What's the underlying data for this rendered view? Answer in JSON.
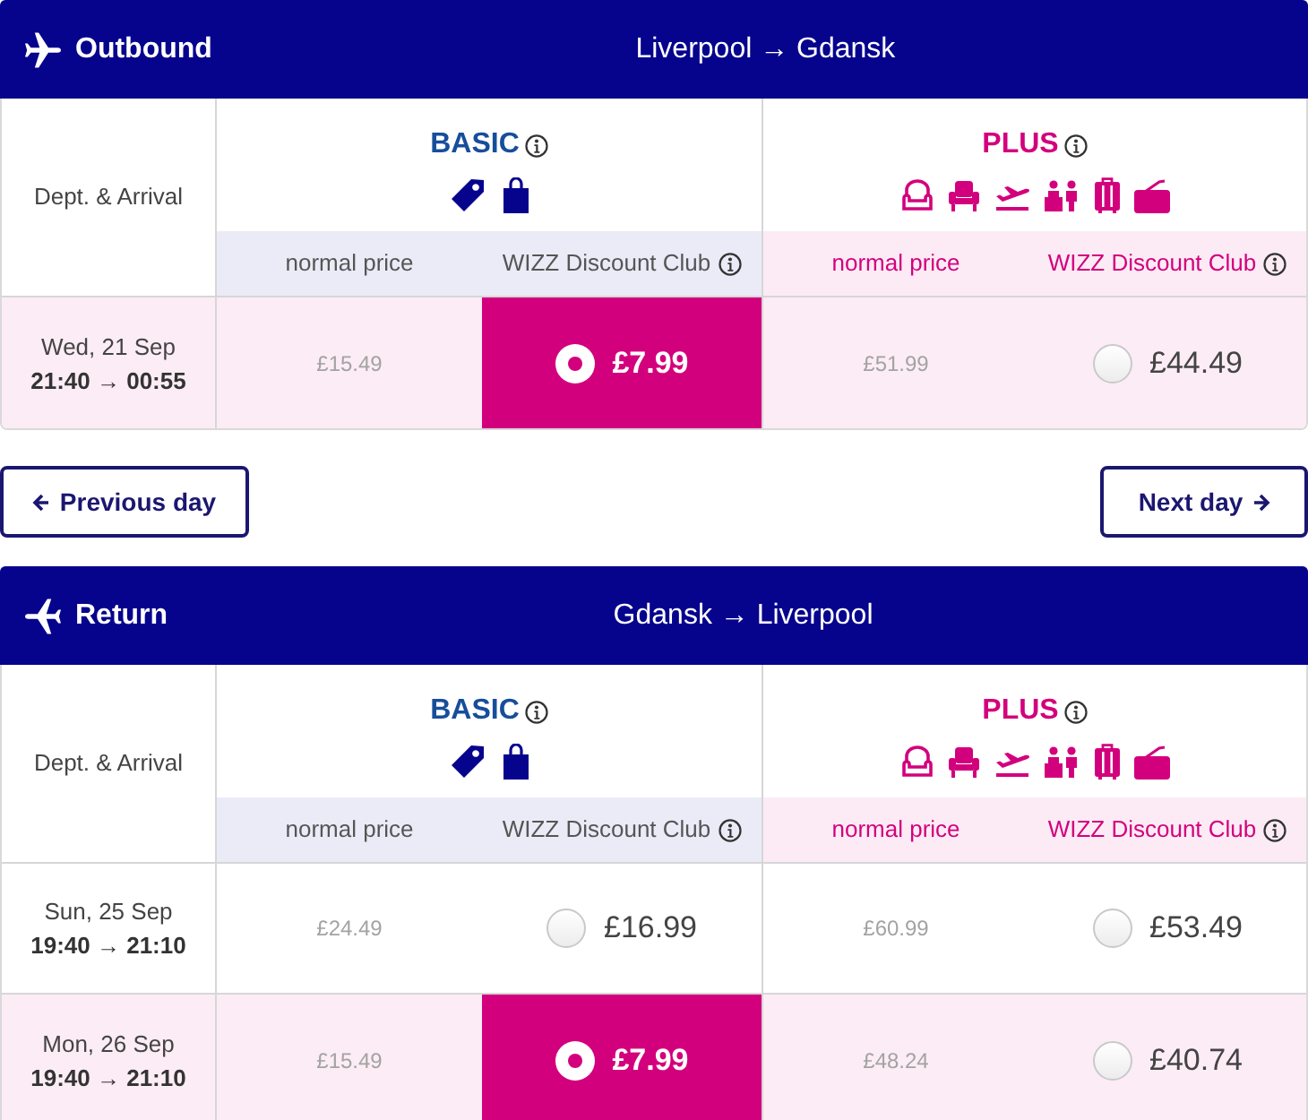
{
  "outbound": {
    "title": "Outbound",
    "route": "Liverpool → Gdansk",
    "date_header": "Dept. & Arrival",
    "fares": [
      {
        "kind": "basic",
        "name": "BASIC",
        "normal_label": "normal price",
        "club_label": "WIZZ Discount Club"
      },
      {
        "kind": "plus",
        "name": "PLUS",
        "normal_label": "normal price",
        "club_label": "WIZZ Discount Club"
      }
    ],
    "rows": [
      {
        "date": "Wed, 21 Sep",
        "times": "21:40 → 00:55",
        "selected": true,
        "prices": [
          {
            "normal": "£15.49",
            "club": "£7.99",
            "selected": true
          },
          {
            "normal": "£51.99",
            "club": "£44.49",
            "selected": false
          }
        ]
      }
    ]
  },
  "day_nav": {
    "previous": "Previous day",
    "next": "Next day"
  },
  "return": {
    "title": "Return",
    "route": "Gdansk → Liverpool",
    "date_header": "Dept. & Arrival",
    "fares": [
      {
        "kind": "basic",
        "name": "BASIC",
        "normal_label": "normal price",
        "club_label": "WIZZ Discount Club"
      },
      {
        "kind": "plus",
        "name": "PLUS",
        "normal_label": "normal price",
        "club_label": "WIZZ Discount Club"
      }
    ],
    "rows": [
      {
        "date": "Sun, 25 Sep",
        "times": "19:40 → 21:10",
        "selected": false,
        "prices": [
          {
            "normal": "£24.49",
            "club": "£16.99",
            "selected": false
          },
          {
            "normal": "£60.99",
            "club": "£53.49",
            "selected": false
          }
        ]
      },
      {
        "date": "Mon, 26 Sep",
        "times": "19:40 → 21:10",
        "selected": true,
        "prices": [
          {
            "normal": "£15.49",
            "club": "£7.99",
            "selected": true
          },
          {
            "normal": "£48.24",
            "club": "£40.74",
            "selected": false
          }
        ]
      }
    ]
  }
}
